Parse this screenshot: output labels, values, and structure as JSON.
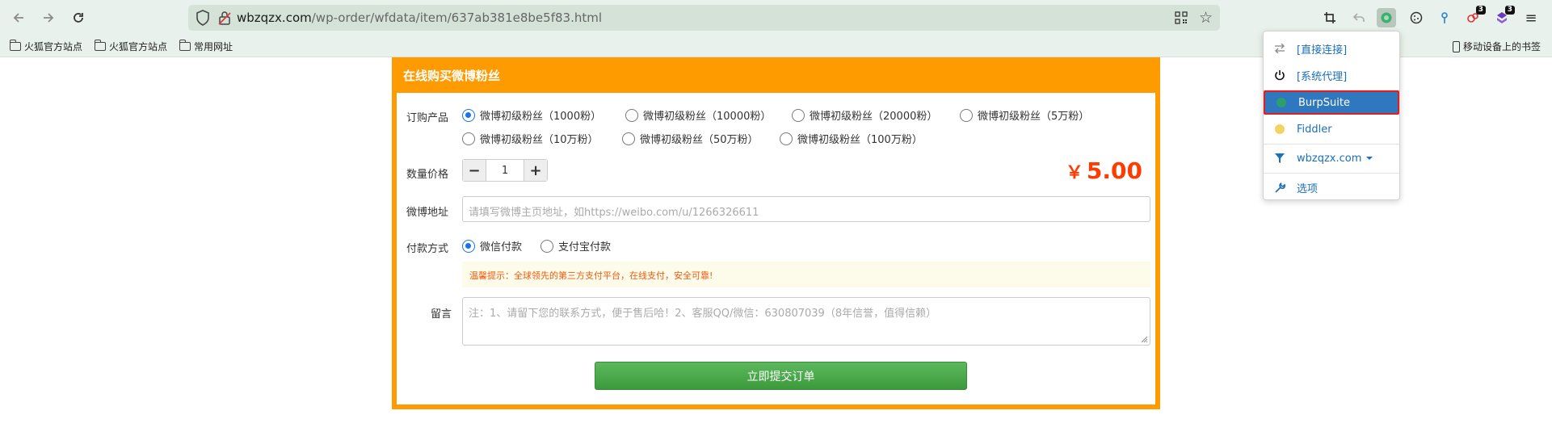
{
  "browser": {
    "url_domain": "wbzqzx.com",
    "url_path": "/wp-order/wfdata/item/637ab381e8be5f83.html",
    "badges": {
      "extension_1": "3",
      "extension_2": "3"
    },
    "bookmarks": [
      "火狐官方站点",
      "火狐官方站点",
      "常用网址"
    ],
    "mobile_bookmarks": "移动设备上的书签"
  },
  "form": {
    "title": "在线购买微博粉丝",
    "product_label": "订购产品",
    "products": [
      "微博初级粉丝（1000粉）",
      "微博初级粉丝（10000粉）",
      "微博初级粉丝（20000粉）",
      "微博初级粉丝（5万粉）",
      "微博初级粉丝（10万粉）",
      "微博初级粉丝（50万粉）",
      "微博初级粉丝（100万粉）"
    ],
    "selected_product_index": 0,
    "quantity_label": "数量价格",
    "quantity": "1",
    "minus": "−",
    "plus": "+",
    "price_currency": "￥",
    "price": "5.00",
    "address_label": "微博地址",
    "address_placeholder": "请填写微博主页地址，如https://weibo.com/u/1266326611",
    "payment_label": "付款方式",
    "payment_options": [
      "微信付款",
      "支付宝付款"
    ],
    "selected_payment_index": 0,
    "tip": "温馨提示：全球领先的第三方支付平台，在线支付，安全可靠!",
    "message_label": "留言",
    "message_placeholder": "注：1、请留下您的联系方式，便于售后哈！2、客服QQ/微信：630807039（8年信誉，值得信赖）",
    "submit": "立即提交订单"
  },
  "proxy_menu": {
    "items": [
      "[直接连接]",
      "[系统代理]",
      "BurpSuite",
      "Fiddler",
      "wbzqzx.com",
      "选项"
    ],
    "selected": "BurpSuite",
    "colors": {
      "burpsuite": "#2e9e6a",
      "fiddler": "#f4d35e",
      "selected_bg": "#2f78bf",
      "highlight_border": "#e02020"
    }
  },
  "colors": {
    "accent_orange": "#fe9b00",
    "price_red": "#ff3b00",
    "submit_green": "#4cae4c",
    "radio_blue": "#1a73e8"
  }
}
